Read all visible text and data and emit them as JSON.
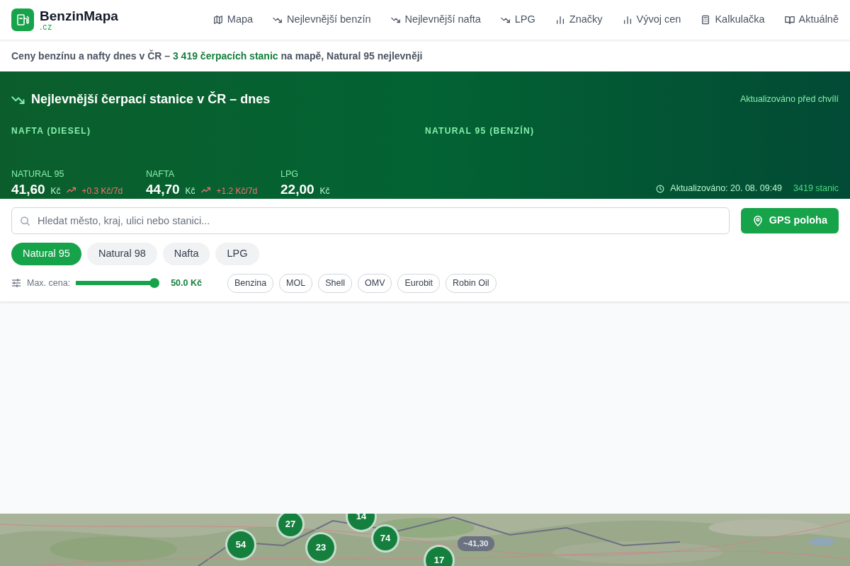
{
  "logo": {
    "name": "BenzinMapa",
    "suffix": ".cz"
  },
  "nav": [
    {
      "label": "Mapa",
      "kind": "map"
    },
    {
      "label": "Nejlevnější benzín",
      "kind": "trend"
    },
    {
      "label": "Nejlevnější nafta",
      "kind": "trend"
    },
    {
      "label": "LPG",
      "kind": "trend"
    },
    {
      "label": "Značky",
      "kind": "chart"
    },
    {
      "label": "Vývoj cen",
      "kind": "chart"
    },
    {
      "label": "Kalkulačka",
      "kind": "calc"
    },
    {
      "label": "Aktuálně",
      "kind": "book"
    }
  ],
  "headline": {
    "before": "Ceny benzínu a nafty dnes v ČR –",
    "highlight": "3 419 čerpacích stanic",
    "after": "na mapě, Natural 95 nejlevněji"
  },
  "hero": {
    "title": "Nejlevnější čerpací stanice v ČR – dnes",
    "updated_note": "Aktualizováno před chvílí",
    "columns": [
      "NAFTA (DIESEL)",
      "NATURAL 95 (BENZÍN)"
    ],
    "stats": [
      {
        "label": "NATURAL 95",
        "price": "41,60",
        "unit": "Kč",
        "change": "+0.3 Kč/7d"
      },
      {
        "label": "NAFTA",
        "price": "44,70",
        "unit": "Kč",
        "change": "+1.2 Kč/7d"
      },
      {
        "label": "LPG",
        "price": "22,00",
        "unit": "Kč"
      }
    ],
    "updated": "Aktualizováno: 20. 08. 09:49",
    "stations": "3419 stanic"
  },
  "search": {
    "placeholder": "Hledat město, kraj, ulici nebo stanici..."
  },
  "gps_button": "GPS poloha",
  "fuel_tabs": [
    {
      "label": "Natural 95",
      "selected": true
    },
    {
      "label": "Natural 98",
      "selected": false
    },
    {
      "label": "Nafta",
      "selected": false
    },
    {
      "label": "LPG",
      "selected": false
    }
  ],
  "max_price": {
    "label": "Max. cena:",
    "level": 1,
    "value": "50.0 Kč"
  },
  "brands": [
    "Benzina",
    "MOL",
    "Shell",
    "OMV",
    "Eurobit",
    "Robin Oil"
  ],
  "map_markers": [
    {
      "kind": "cluster",
      "label": "14"
    },
    {
      "kind": "cluster",
      "label": "27"
    },
    {
      "kind": "cluster",
      "label": "54"
    },
    {
      "kind": "cluster",
      "label": "23"
    },
    {
      "kind": "cluster",
      "label": "74"
    },
    {
      "kind": "cluster",
      "label": "17"
    },
    {
      "kind": "price",
      "label": "~41,30"
    }
  ]
}
